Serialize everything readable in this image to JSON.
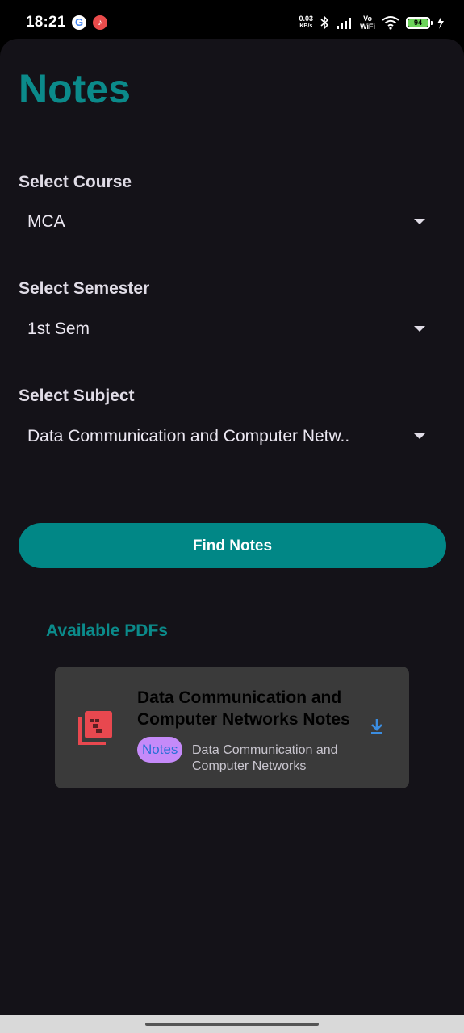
{
  "status_bar": {
    "time": "18:21",
    "google_glyph": "G",
    "app_glyph": "♪",
    "net_speed_value": "0.03",
    "net_speed_unit": "KB/s",
    "vo": "Vo",
    "wifi": "WiFi",
    "battery": "94",
    "icons": [
      "google-icon",
      "music-app-icon",
      "bluetooth-icon",
      "signal-icon",
      "wifi-icon",
      "battery-icon",
      "charging-icon"
    ]
  },
  "page": {
    "title": "Notes"
  },
  "form": {
    "course": {
      "label": "Select Course",
      "value": "MCA"
    },
    "semester": {
      "label": "Select Semester",
      "value": "1st Sem"
    },
    "subject": {
      "label": "Select Subject",
      "value": "Data Communication and Computer Netw.."
    },
    "find_button": "Find Notes"
  },
  "pdfs": {
    "section_title": "Available PDFs",
    "items": [
      {
        "title": "Data Communication and Computer Networks Notes",
        "tag": "Notes",
        "subject": "Data Communication and Computer Networks",
        "icon": "pdf-file-icon",
        "action_icon": "download-icon"
      }
    ]
  },
  "colors": {
    "accent": "#0b8a8a",
    "button": "#018786",
    "background": "#141218",
    "card": "#3a3a3a",
    "chip": "#c58af9",
    "pdf_icon": "#e8484f",
    "download": "#3b8de0"
  }
}
